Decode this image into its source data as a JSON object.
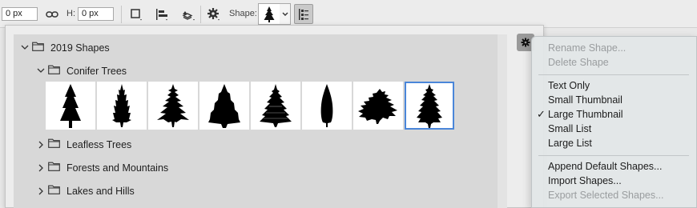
{
  "toolbar": {
    "width_value": "0 px",
    "height_label": "H:",
    "height_value": "0 px",
    "shape_label": "Shape:"
  },
  "panel": {
    "rows": [
      {
        "label": "2019 Shapes",
        "expanded": true
      },
      {
        "label": "Conifer Trees",
        "expanded": true
      },
      {
        "label": "Leafless Trees",
        "expanded": false
      },
      {
        "label": "Forests and Mountains",
        "expanded": false
      },
      {
        "label": "Lakes and Hills",
        "expanded": false
      }
    ],
    "thumbnails": [
      {
        "icon": "conifer-tree-1-icon",
        "selected": false
      },
      {
        "icon": "conifer-tree-2-icon",
        "selected": false
      },
      {
        "icon": "conifer-tree-3-icon",
        "selected": false
      },
      {
        "icon": "conifer-tree-4-icon",
        "selected": false
      },
      {
        "icon": "conifer-tree-5-icon",
        "selected": false
      },
      {
        "icon": "conifer-tree-6-icon",
        "selected": false
      },
      {
        "icon": "conifer-tree-7-icon",
        "selected": false
      },
      {
        "icon": "conifer-tree-8-icon",
        "selected": true
      }
    ]
  },
  "menu": {
    "items": [
      {
        "label": "Rename Shape...",
        "enabled": false,
        "checked": false
      },
      {
        "label": "Delete Shape",
        "enabled": false,
        "checked": false
      },
      {
        "label": "Text Only",
        "enabled": true,
        "checked": false
      },
      {
        "label": "Small Thumbnail",
        "enabled": true,
        "checked": false
      },
      {
        "label": "Large Thumbnail",
        "enabled": true,
        "checked": true
      },
      {
        "label": "Small List",
        "enabled": true,
        "checked": false
      },
      {
        "label": "Large List",
        "enabled": true,
        "checked": false
      },
      {
        "label": "Append Default Shapes...",
        "enabled": true,
        "checked": false
      },
      {
        "label": "Import Shapes...",
        "enabled": true,
        "checked": false
      },
      {
        "label": "Export Selected Shapes...",
        "enabled": false,
        "checked": false
      }
    ],
    "check_glyph": "✓"
  },
  "colors": {
    "selection_outline": "#4a86d9",
    "disabled_text": "#9a9d9f"
  }
}
